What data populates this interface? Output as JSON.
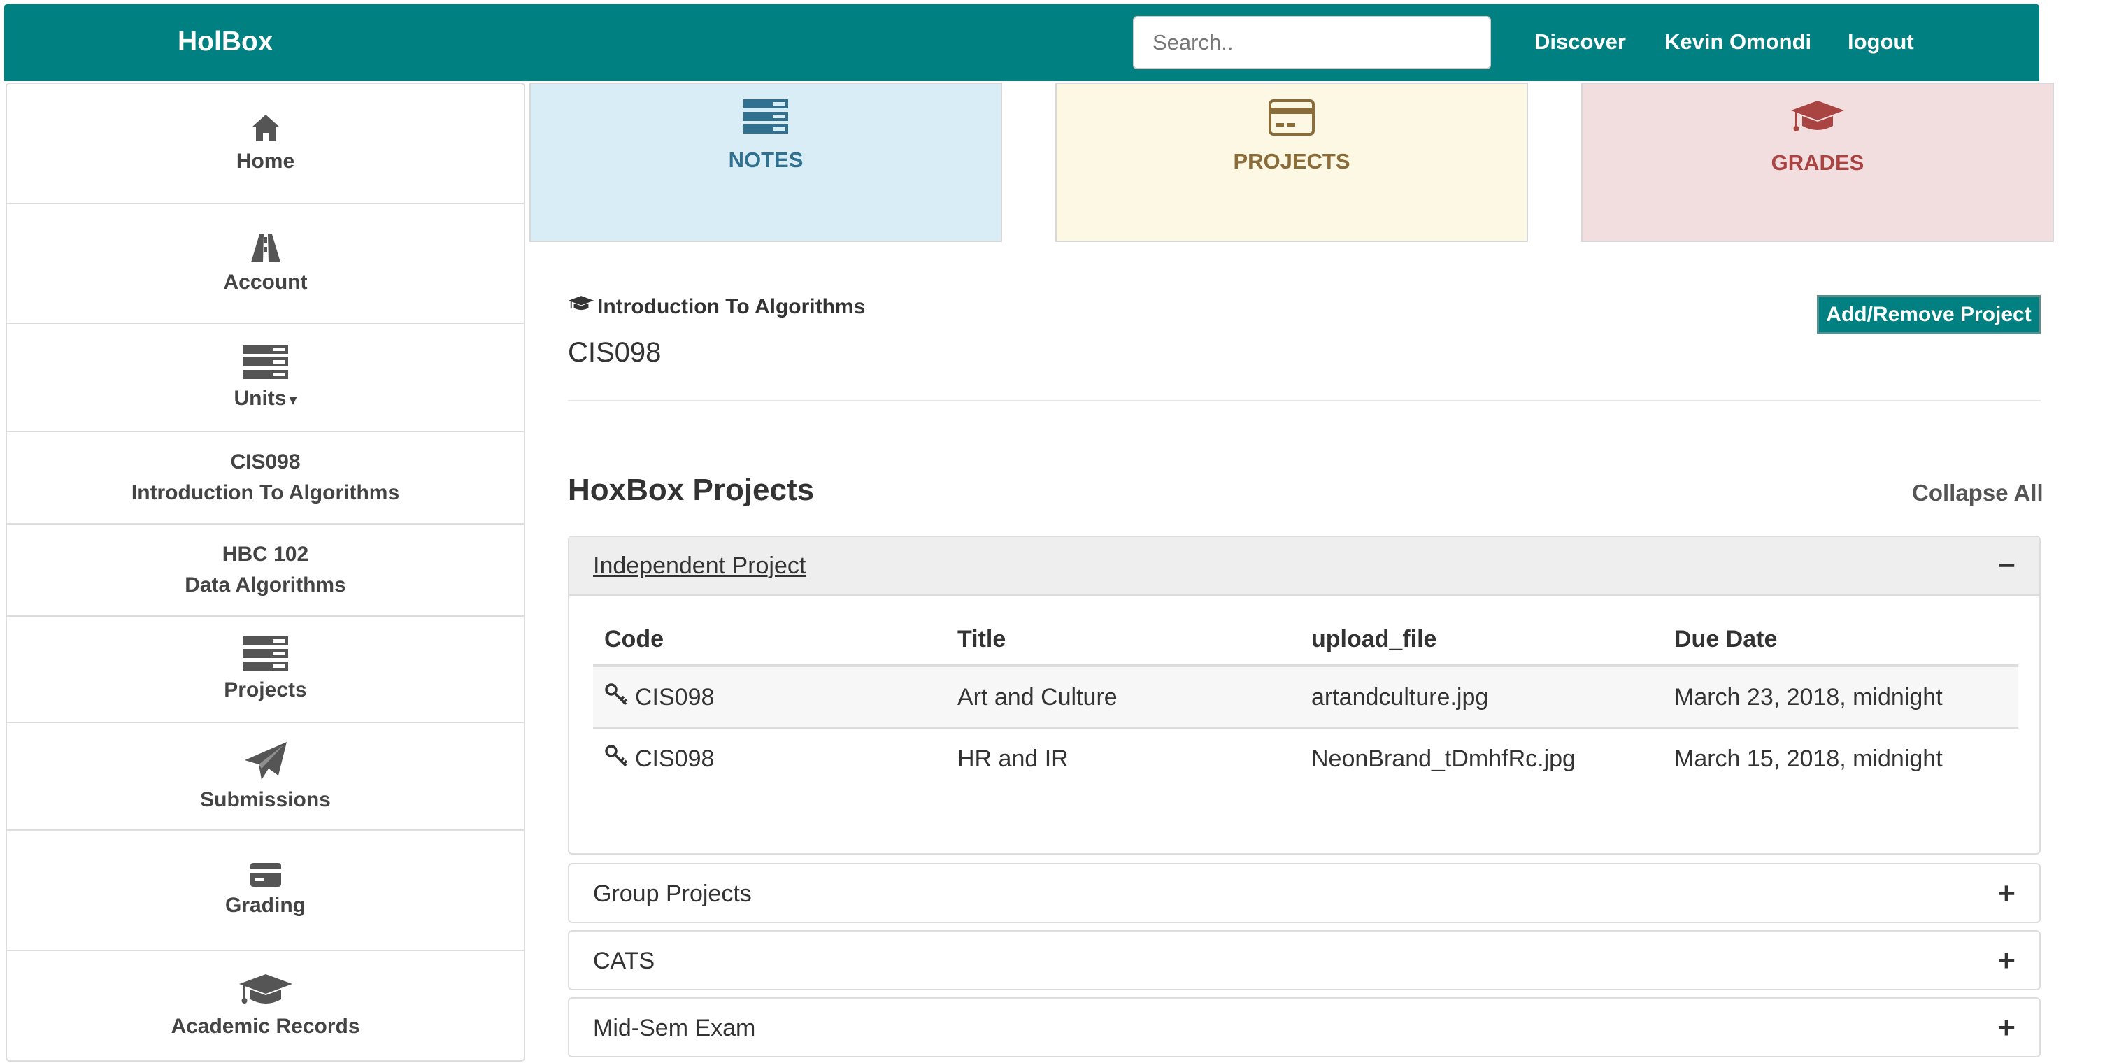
{
  "header": {
    "brand": "HolBox",
    "search_placeholder": "Search..",
    "nav": [
      "Discover",
      "Kevin Omondi",
      "logout"
    ],
    "bg_color": "#008080"
  },
  "sidebar": {
    "items": [
      {
        "label": "Home",
        "icon": "home-icon"
      },
      {
        "label": "Account",
        "icon": "road-icon"
      },
      {
        "label": "Units",
        "icon": "server-icon",
        "has_caret": true
      },
      {
        "code": "CIS098",
        "name": "Introduction To Algorithms"
      },
      {
        "code": "HBC 102",
        "name": "Data Algorithms"
      },
      {
        "label": "Projects",
        "icon": "server-icon"
      },
      {
        "label": "Submissions",
        "icon": "paper-plane-icon"
      },
      {
        "label": "Grading",
        "icon": "credit-card-icon"
      },
      {
        "label": "Academic Records",
        "icon": "graduation-cap-icon"
      }
    ]
  },
  "tiles": [
    {
      "label": "NOTES",
      "icon": "server-icon",
      "bg": "#d9edf7",
      "fg": "#31708f"
    },
    {
      "label": "PROJECTS",
      "icon": "credit-card-icon",
      "bg": "#fcf8e3",
      "fg": "#8a6d3b"
    },
    {
      "label": "GRADES",
      "icon": "graduation-cap-icon",
      "bg": "#f2dede",
      "fg": "#a94442"
    }
  ],
  "unit": {
    "title": "Introduction To Algorithms",
    "code": "CIS098",
    "add_button": "Add/Remove Project"
  },
  "projects": {
    "heading": "HoxBox Projects",
    "collapse_all": "Collapse All",
    "panels": [
      {
        "title": "Independent Project",
        "expanded": true,
        "toggle": "−",
        "columns": [
          "Code",
          "Title",
          "upload_file",
          "Due Date"
        ],
        "rows": [
          {
            "code": "CIS098",
            "title": "Art and Culture",
            "file": "artandculture.jpg",
            "due": "March 23, 2018, midnight"
          },
          {
            "code": "CIS098",
            "title": "HR and IR",
            "file": "NeonBrand_tDmhfRc.jpg",
            "due": "March 15, 2018, midnight"
          }
        ]
      },
      {
        "title": "Group Projects",
        "expanded": false,
        "toggle": "+"
      },
      {
        "title": "CATS",
        "expanded": false,
        "toggle": "+"
      },
      {
        "title": "Mid-Sem Exam",
        "expanded": false,
        "toggle": "+"
      }
    ]
  }
}
